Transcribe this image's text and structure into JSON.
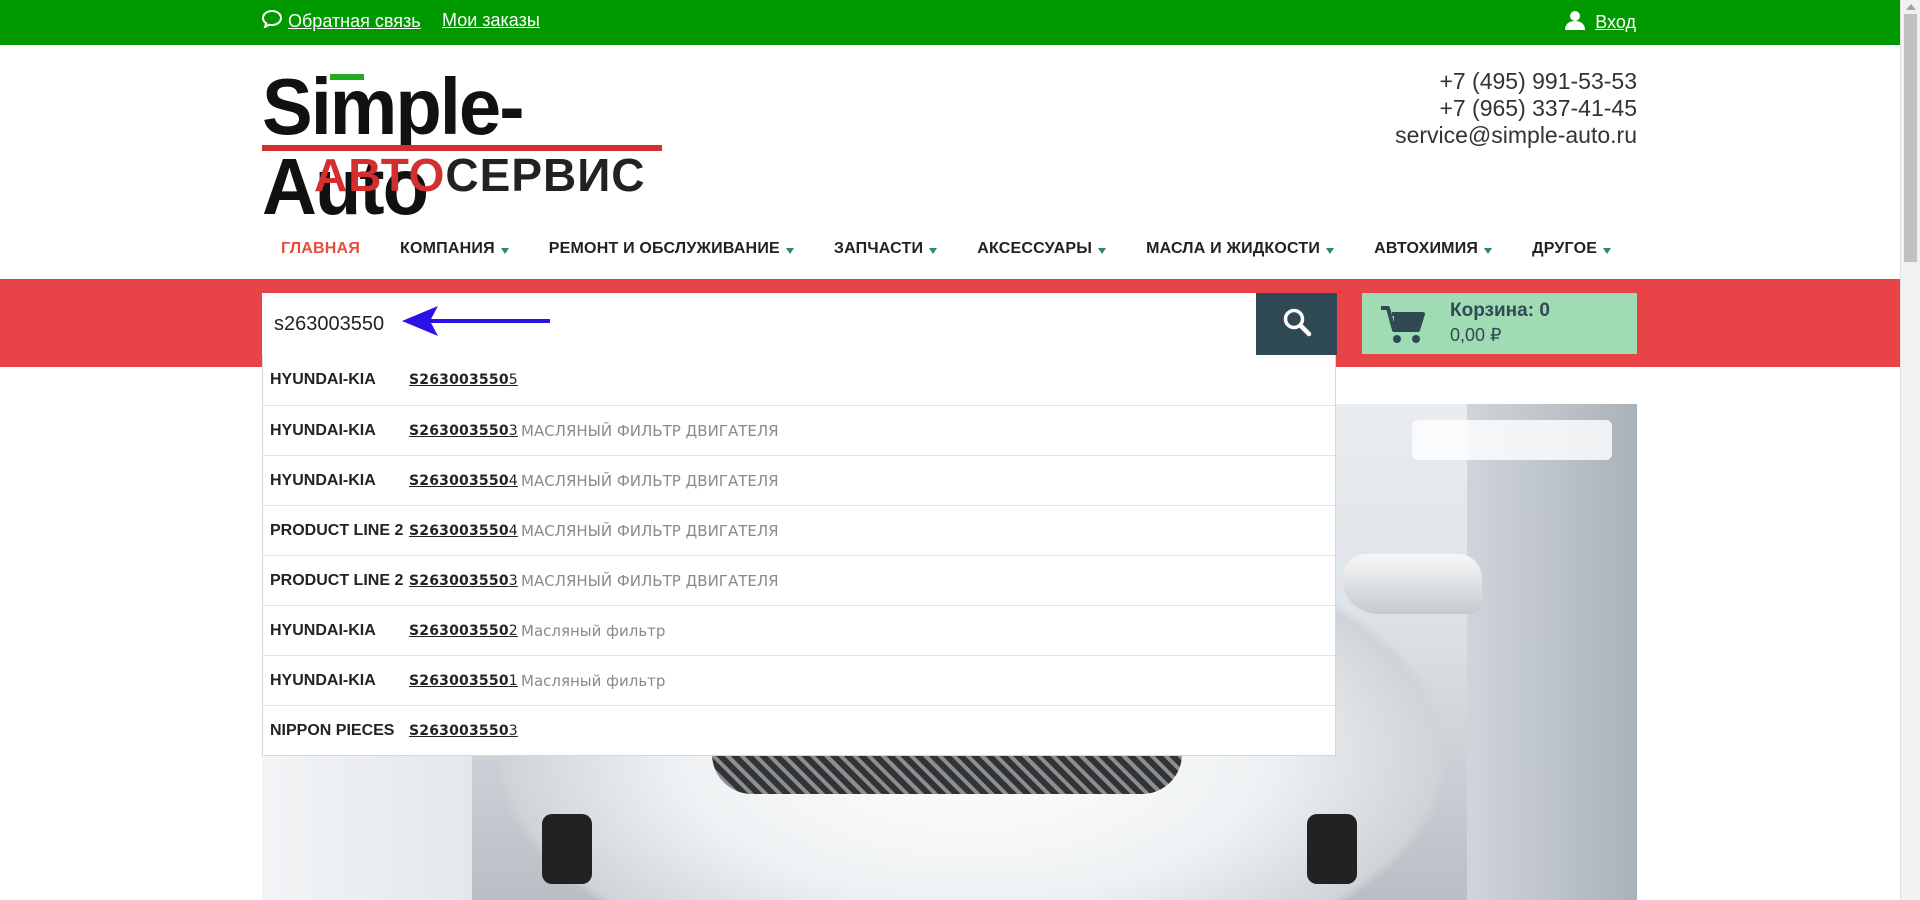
{
  "topbar": {
    "feedback_label": "Обратная связь",
    "orders_label": "Мои заказы",
    "login_label": "Вход"
  },
  "logo": {
    "brand_text": "Simple-Auto",
    "sub_red": "АВТО",
    "sub_dark": "СЕРВИС"
  },
  "contacts": {
    "phone1": "+7 (495) 991-53-53",
    "phone2": "+7 (965) 337-41-45",
    "email": "service@simple-auto.ru"
  },
  "nav": {
    "items": [
      {
        "label": "ГЛАВНАЯ"
      },
      {
        "label": "КОМПАНИЯ"
      },
      {
        "label": "РЕМОНТ И ОБСЛУЖИВАНИЕ"
      },
      {
        "label": "ЗАПЧАСТИ"
      },
      {
        "label": "АКСЕССУАРЫ"
      },
      {
        "label": "МАСЛА И ЖИДКОСТИ"
      },
      {
        "label": "АВТОХИМИЯ"
      },
      {
        "label": "ДРУГОЕ"
      }
    ]
  },
  "search": {
    "value": "s263003550"
  },
  "cart": {
    "title": "Корзина: 0",
    "sum": "0,00 ₽"
  },
  "suggestions": [
    {
      "brand": "HYUNDAI-KIA",
      "code_match": "S263003550",
      "code_rest": "5",
      "desc": ""
    },
    {
      "brand": "HYUNDAI-KIA",
      "code_match": "S263003550",
      "code_rest": "3",
      "desc": "МАСЛЯНЫЙ ФИЛЬТР ДВИГАТЕЛЯ"
    },
    {
      "brand": "HYUNDAI-KIA",
      "code_match": "S263003550",
      "code_rest": "4",
      "desc": "МАСЛЯНЫЙ ФИЛЬТР ДВИГАТЕЛЯ"
    },
    {
      "brand": "PRODUCT LINE 2",
      "code_match": "S263003550",
      "code_rest": "4",
      "desc": "МАСЛЯНЫЙ ФИЛЬТР ДВИГАТЕЛЯ"
    },
    {
      "brand": "PRODUCT LINE 2",
      "code_match": "S263003550",
      "code_rest": "3",
      "desc": "МАСЛЯНЫЙ ФИЛЬТР ДВИГАТЕЛЯ"
    },
    {
      "brand": "HYUNDAI-KIA",
      "code_match": "S263003550",
      "code_rest": "2",
      "desc": "Масляный фильтр"
    },
    {
      "brand": "HYUNDAI-KIA",
      "code_match": "S263003550",
      "code_rest": "1",
      "desc": "Масляный фильтр"
    },
    {
      "brand": "NIPPON PIECES",
      "code_match": "S263003550",
      "code_rest": "3",
      "desc": ""
    }
  ],
  "colors": {
    "topbar": "#009900",
    "band": "#e84448",
    "search_button": "#2f4a55",
    "cart": "#9fdcb3",
    "nav_active": "#e74c3c",
    "annotation_arrow": "#2a12e6"
  },
  "icons": [
    "chat-bubble-icon",
    "user-icon",
    "search-icon",
    "cart-icon",
    "caret-down-icon",
    "annotation-arrow-icon"
  ]
}
